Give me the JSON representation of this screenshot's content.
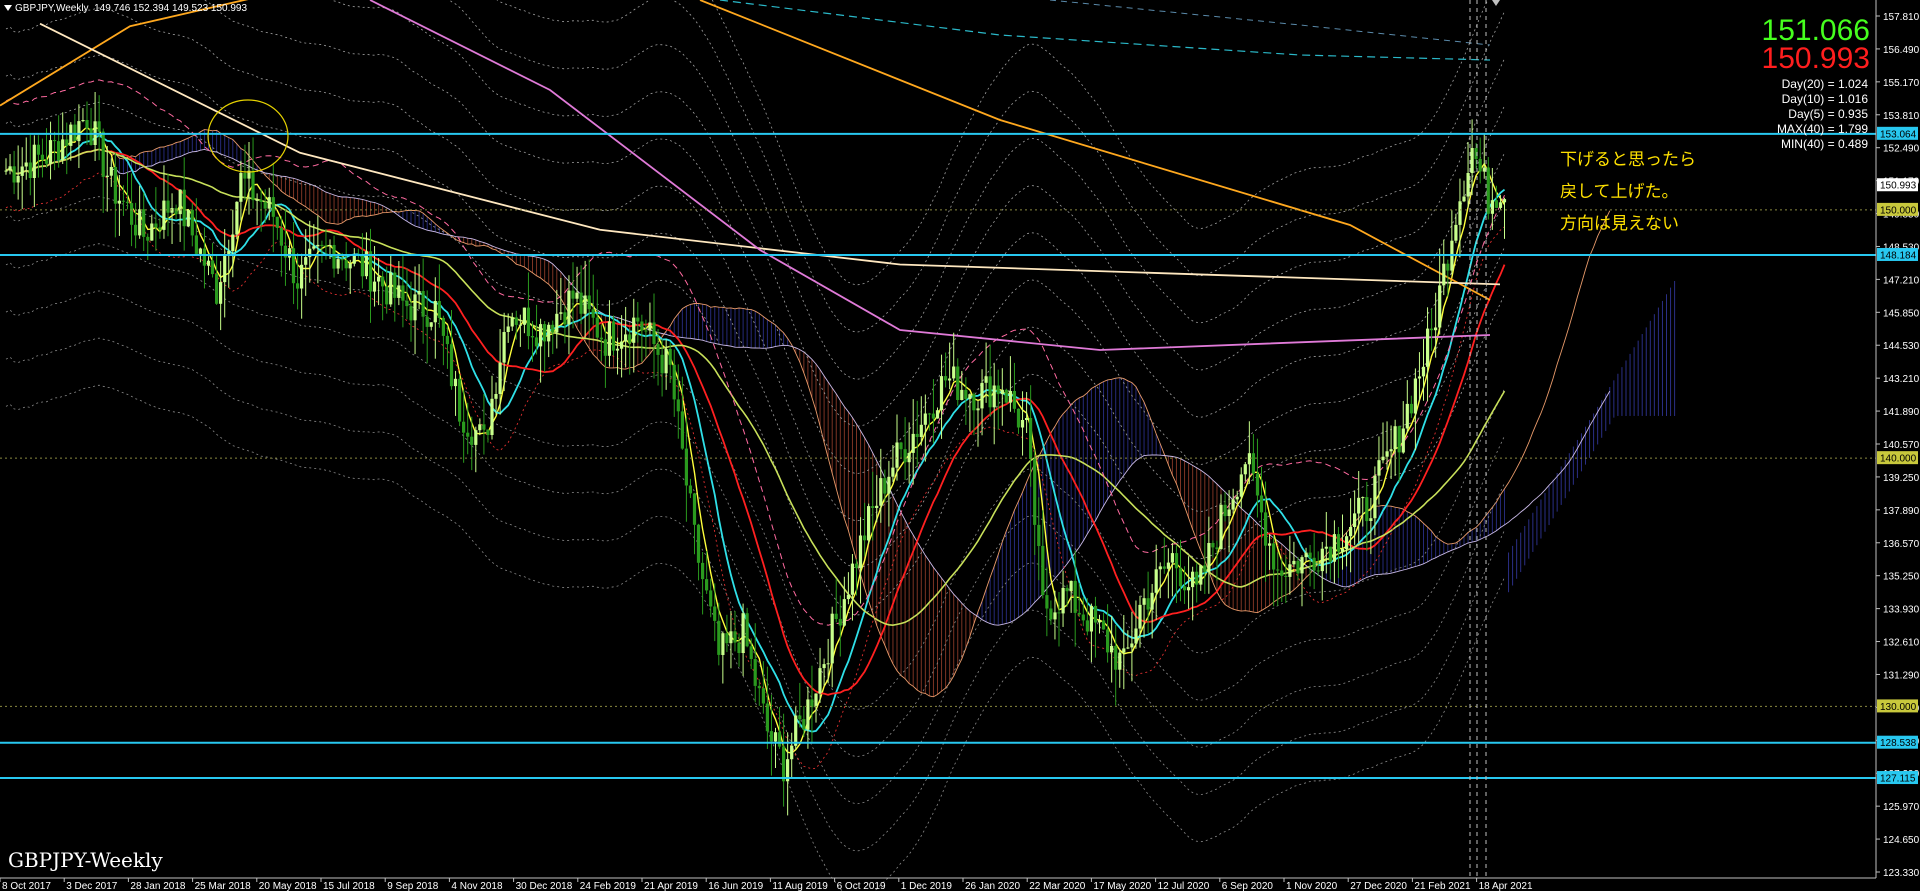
{
  "title_bar": {
    "symbol": "GBPJPY,Weekly",
    "ohlc": "149.746 152.394 149.523 150.993"
  },
  "price_display": {
    "bid": "151.066",
    "ask": "150.993"
  },
  "stats": [
    "Day(20) = 1.024",
    "Day(10) = 1.016",
    "Day(5) = 0.935",
    "MAX(40) = 1.799",
    "MIN(40) = 0.489"
  ],
  "notes": [
    "下げると思ったら",
    "戻して上げた。",
    "方向は見えない"
  ],
  "symbol_label": "GBPJPY-Weekly",
  "colors": {
    "background": "#000000",
    "bull_candle": "#c8ff8c",
    "bear_candle": "#2a9a1e",
    "horizontal_line": "#28c8f0",
    "note_text": "#ffe100",
    "bid": "#46ff1e",
    "ask": "#ff1e1e"
  },
  "price_axis": {
    "labels": [
      "157.810",
      "156.490",
      "155.170",
      "153.810",
      "152.490",
      "151.170",
      "149.850",
      "148.530",
      "147.210",
      "145.850",
      "144.530",
      "143.210",
      "141.890",
      "140.570",
      "139.250",
      "137.890",
      "136.570",
      "135.250",
      "133.930",
      "132.610",
      "131.290",
      "129.930",
      "128.610",
      "127.290",
      "125.970",
      "124.650",
      "123.330"
    ],
    "tags": [
      "153.064",
      "150.993",
      "150.000",
      "148.184",
      "140.000",
      "130.000",
      "128.538",
      "127.115"
    ]
  },
  "time_axis": {
    "labels": [
      "8 Oct 2017",
      "3 Dec 2017",
      "28 Jan 2018",
      "25 Mar 2018",
      "20 May 2018",
      "15 Jul 2018",
      "9 Sep 2018",
      "4 Nov 2018",
      "30 Dec 2018",
      "24 Feb 2019",
      "21 Apr 2019",
      "16 Jun 2019",
      "11 Aug 2019",
      "6 Oct 2019",
      "1 Dec 2019",
      "26 Jan 2020",
      "22 Mar 2020",
      "17 May 2020",
      "12 Jul 2020",
      "6 Sep 2020",
      "1 Nov 2020",
      "27 Dec 2020",
      "21 Feb 2021",
      "18 Apr 2021"
    ]
  },
  "chart_data": {
    "type": "line",
    "ylim": [
      123.33,
      157.81
    ],
    "horizontal_levels": [
      153.064,
      148.184,
      128.538,
      127.115
    ],
    "dotted_levels": [
      150.0,
      140.0,
      130.0
    ],
    "price_path": [
      [
        0,
        151.6
      ],
      [
        10,
        152.2
      ],
      [
        20,
        153.8
      ],
      [
        26,
        151.0
      ],
      [
        34,
        149.0
      ],
      [
        42,
        150.5
      ],
      [
        52,
        146.8
      ],
      [
        58,
        151.2
      ],
      [
        66,
        149.8
      ],
      [
        72,
        147.2
      ],
      [
        80,
        148.5
      ],
      [
        90,
        147.5
      ],
      [
        98,
        146.2
      ],
      [
        106,
        146.0
      ],
      [
        112,
        142.0
      ],
      [
        118,
        140.6
      ],
      [
        124,
        146.0
      ],
      [
        132,
        145.2
      ],
      [
        140,
        146.5
      ],
      [
        148,
        144.8
      ],
      [
        156,
        145.6
      ],
      [
        164,
        143.5
      ],
      [
        170,
        136.7
      ],
      [
        176,
        132.0
      ],
      [
        182,
        133.0
      ],
      [
        188,
        129.0
      ],
      [
        192,
        127.7
      ],
      [
        198,
        130.0
      ],
      [
        206,
        134.0
      ],
      [
        212,
        137.0
      ],
      [
        218,
        139.5
      ],
      [
        226,
        141.5
      ],
      [
        232,
        143.2
      ],
      [
        240,
        142.6
      ],
      [
        246,
        143.0
      ],
      [
        252,
        141.0
      ],
      [
        256,
        134.0
      ],
      [
        262,
        134.5
      ],
      [
        270,
        133.0
      ],
      [
        276,
        131.6
      ],
      [
        280,
        134.0
      ],
      [
        288,
        136.0
      ],
      [
        294,
        134.5
      ],
      [
        300,
        137.5
      ],
      [
        306,
        140.0
      ],
      [
        314,
        135.5
      ],
      [
        322,
        136.0
      ],
      [
        330,
        137.0
      ],
      [
        336,
        138.0
      ],
      [
        344,
        141.0
      ],
      [
        352,
        145.0
      ],
      [
        358,
        150.0
      ],
      [
        362,
        152.5
      ],
      [
        366,
        150.5
      ],
      [
        370,
        151.0
      ]
    ]
  }
}
